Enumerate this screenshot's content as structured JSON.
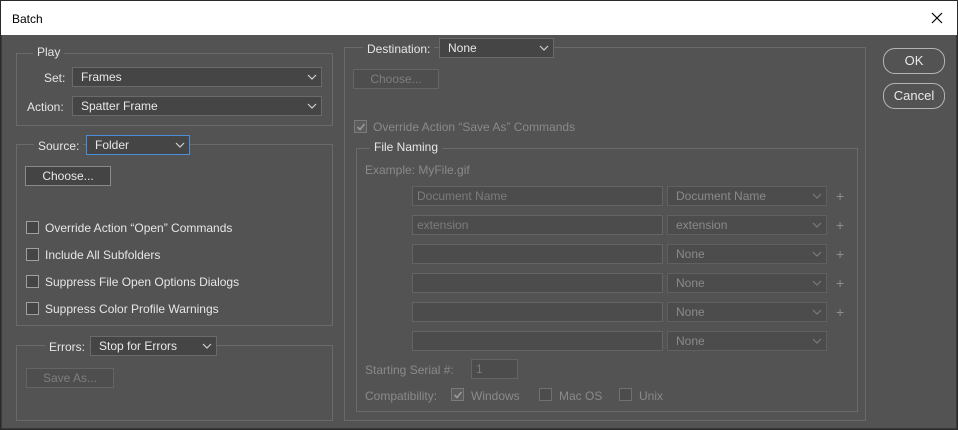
{
  "window": {
    "title": "Batch"
  },
  "play": {
    "legend": "Play",
    "set_label": "Set:",
    "set_value": "Frames",
    "action_label": "Action:",
    "action_value": "Spatter Frame"
  },
  "source": {
    "label": "Source:",
    "value": "Folder",
    "choose_label": "Choose...",
    "options": [
      {
        "label": "Override Action “Open” Commands",
        "checked": false
      },
      {
        "label": "Include All Subfolders",
        "checked": false
      },
      {
        "label": "Suppress File Open Options Dialogs",
        "checked": false
      },
      {
        "label": "Suppress Color Profile Warnings",
        "checked": false
      }
    ]
  },
  "errors": {
    "label": "Errors:",
    "value": "Stop for Errors",
    "save_as_label": "Save As..."
  },
  "destination": {
    "label": "Destination:",
    "value": "None",
    "choose_label": "Choose...",
    "override_label": "Override Action “Save As” Commands",
    "override_checked": true
  },
  "file_naming": {
    "legend": "File Naming",
    "example": "Example: MyFile.gif",
    "rows": [
      {
        "field": "Document Name",
        "select": "Document Name",
        "plus": "+"
      },
      {
        "field": "extension",
        "select": "extension",
        "plus": "+"
      },
      {
        "field": "",
        "select": "None",
        "plus": "+"
      },
      {
        "field": "",
        "select": "None",
        "plus": "+"
      },
      {
        "field": "",
        "select": "None",
        "plus": "+"
      },
      {
        "field": "",
        "select": "None",
        "plus": ""
      }
    ],
    "serial_label": "Starting Serial #:",
    "serial_value": "1",
    "compat_label": "Compatibility:",
    "compat": [
      {
        "label": "Windows",
        "checked": true
      },
      {
        "label": "Mac OS",
        "checked": false
      },
      {
        "label": "Unix",
        "checked": false
      }
    ]
  },
  "actions": {
    "ok_label": "OK",
    "cancel_label": "Cancel"
  }
}
